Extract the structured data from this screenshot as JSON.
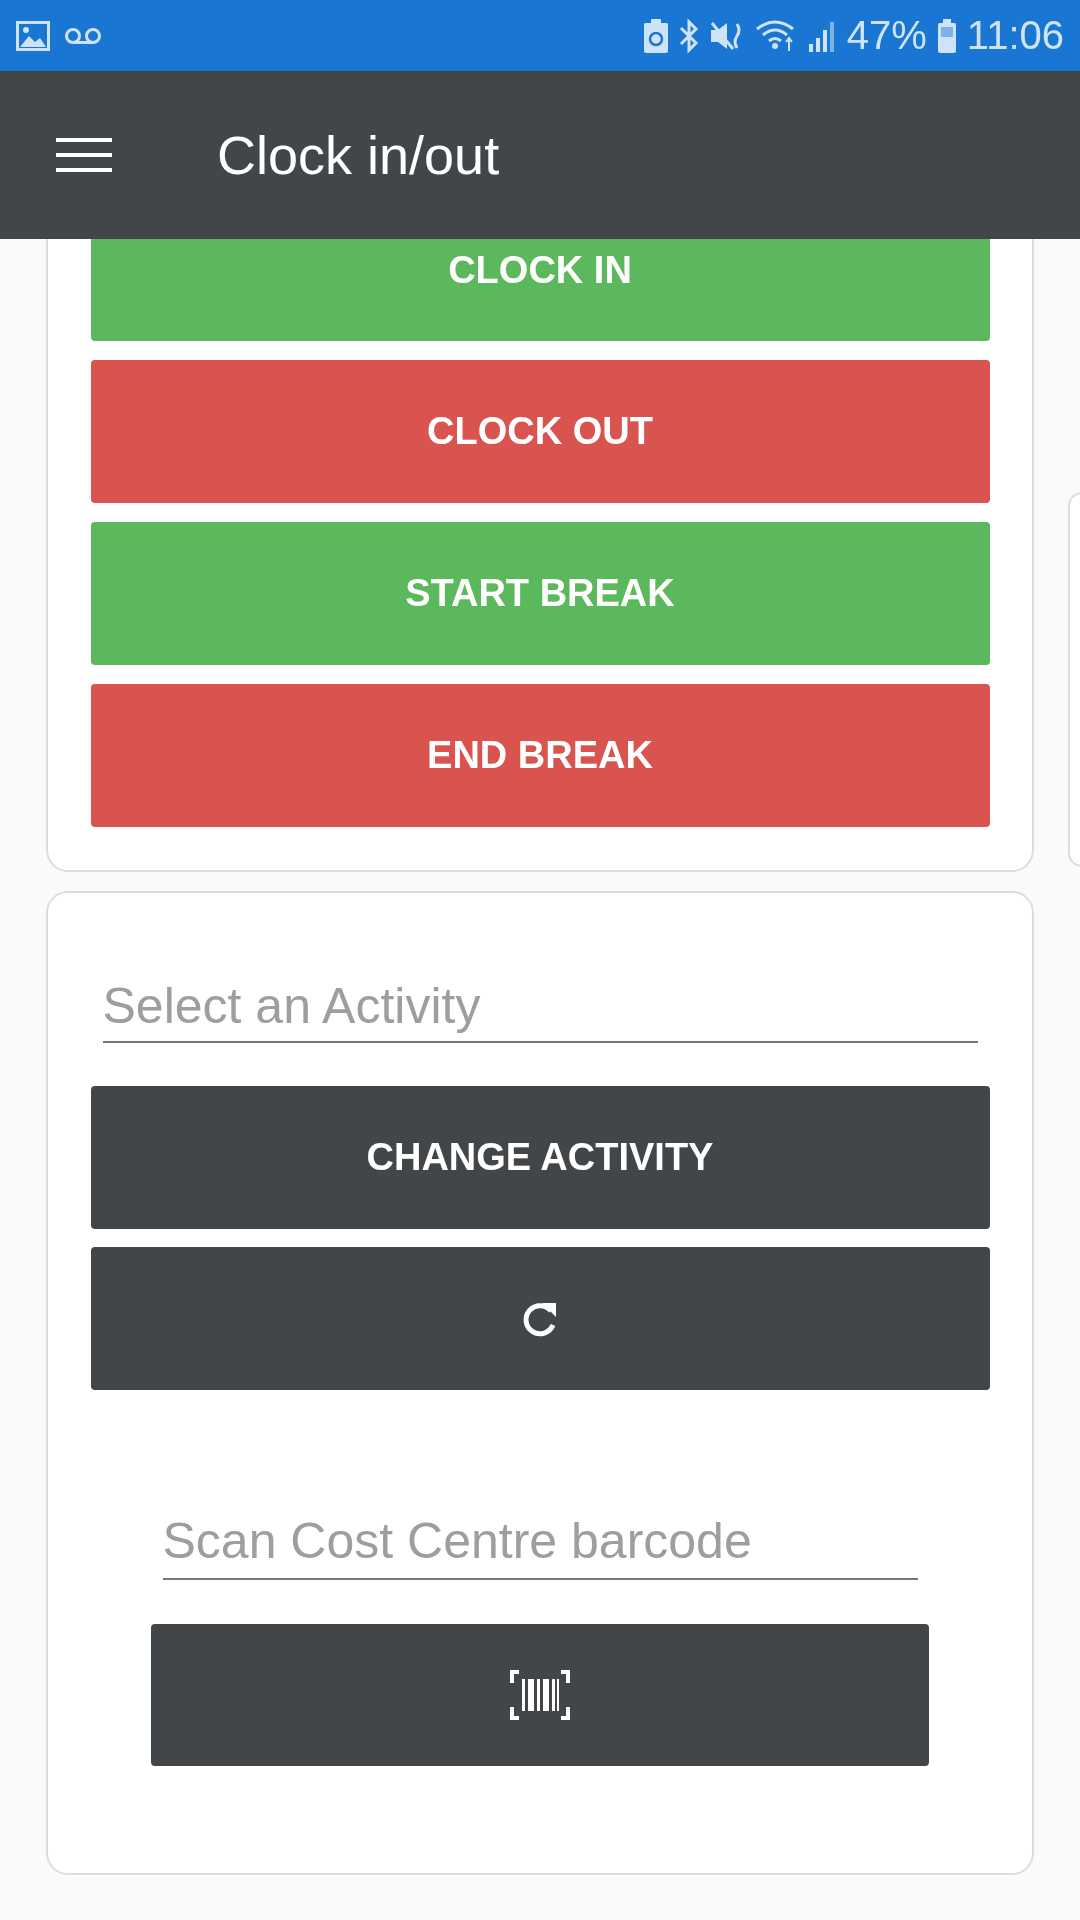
{
  "status_bar": {
    "battery": "47%",
    "time": "11:06"
  },
  "app_bar": {
    "title": "Clock in/out"
  },
  "clock_buttons": [
    {
      "label": "CLOCK IN",
      "kind": "success"
    },
    {
      "label": "CLOCK OUT",
      "kind": "danger"
    },
    {
      "label": "START BREAK",
      "kind": "success"
    },
    {
      "label": "END BREAK",
      "kind": "danger"
    }
  ],
  "activity": {
    "placeholder": "Select an Activity",
    "button": "CHANGE ACTIVITY"
  },
  "cost_centre": {
    "placeholder": "Scan Cost Centre barcode"
  }
}
